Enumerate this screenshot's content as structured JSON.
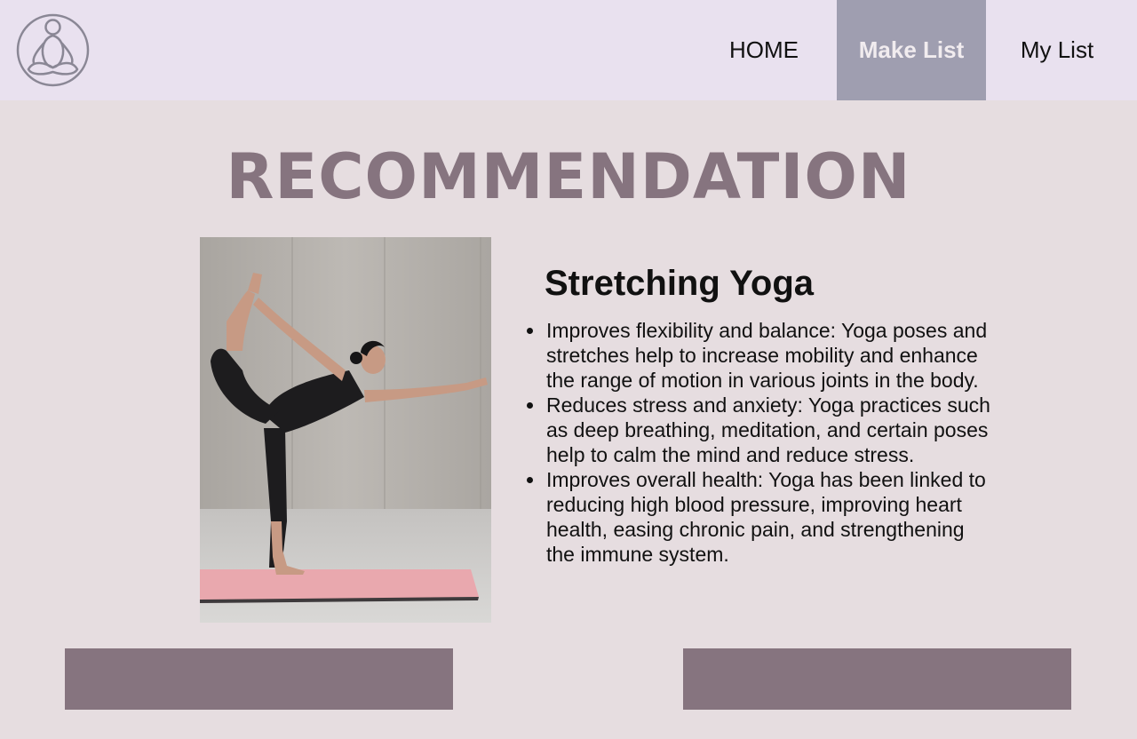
{
  "nav": {
    "logo_icon": "meditation-figure-icon",
    "items": [
      {
        "label": "HOME",
        "active": false
      },
      {
        "label": "Make List",
        "active": true
      },
      {
        "label": "My List",
        "active": false
      }
    ]
  },
  "page": {
    "title": "RECOMMENDATION"
  },
  "recommendation": {
    "image_icon": "yoga-pose-photo",
    "name": "Stretching Yoga",
    "benefits": [
      "Improves flexibility and balance: Yoga poses and stretches help to increase mobility and enhance the range of motion in various joints in the body.",
      "Reduces stress and anxiety: Yoga practices such as deep breathing, meditation, and certain poses help to calm the mind and reduce stress.",
      "Improves overall health: Yoga has been linked to reducing high blood pressure, improving heart health, easing chronic pain, and strengthening the immune system."
    ]
  },
  "actions": {
    "left_label": "",
    "right_label": ""
  },
  "colors": {
    "navbar_bg": "#e9e1ef",
    "page_bg": "#e6dde0",
    "active_nav_bg": "#9f9eb0",
    "accent": "#86747f"
  }
}
